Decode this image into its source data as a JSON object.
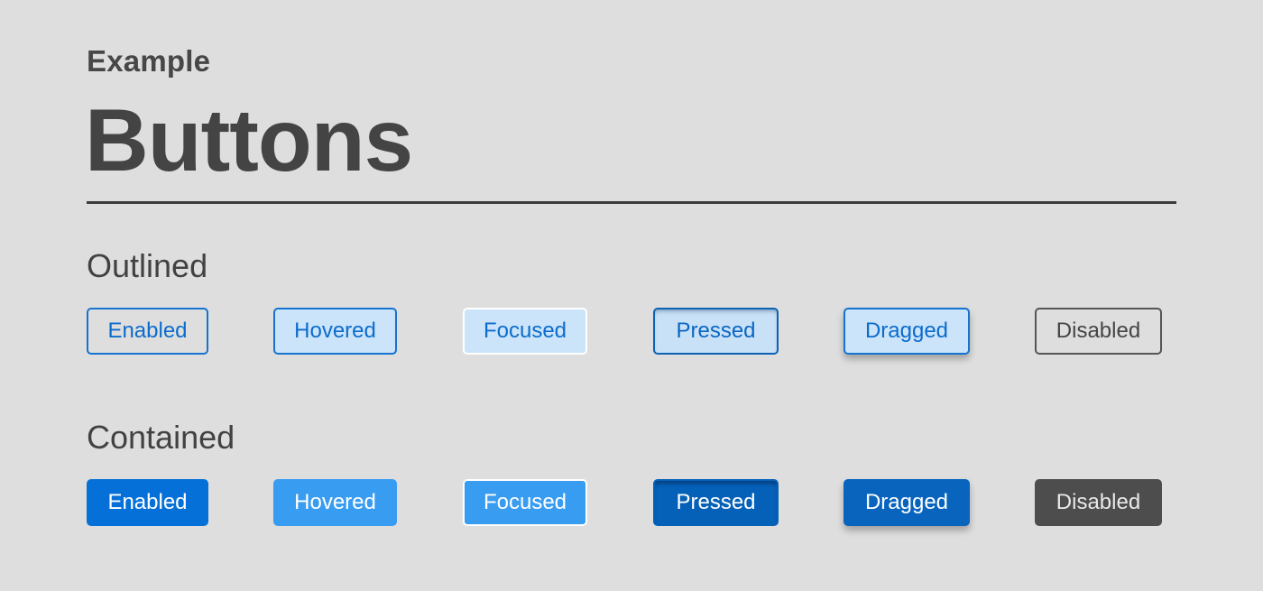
{
  "header": {
    "eyebrow": "Example",
    "title": "Buttons"
  },
  "sections": [
    {
      "heading": "Outlined",
      "buttons": [
        {
          "state": "enabled",
          "label": "Enabled"
        },
        {
          "state": "hovered",
          "label": "Hovered"
        },
        {
          "state": "focused",
          "label": "Focused"
        },
        {
          "state": "pressed",
          "label": "Pressed"
        },
        {
          "state": "dragged",
          "label": "Dragged"
        },
        {
          "state": "disabled",
          "label": "Disabled"
        }
      ]
    },
    {
      "heading": "Contained",
      "buttons": [
        {
          "state": "enabled",
          "label": "Enabled"
        },
        {
          "state": "hovered",
          "label": "Hovered"
        },
        {
          "state": "focused",
          "label": "Focused"
        },
        {
          "state": "pressed",
          "label": "Pressed"
        },
        {
          "state": "dragged",
          "label": "Dragged"
        },
        {
          "state": "disabled",
          "label": "Disabled"
        }
      ]
    }
  ],
  "colors": {
    "background": "#dedede",
    "text": "#454545",
    "primary": "#0571d8",
    "primary_hover": "#389cf1",
    "primary_pressed": "#0561b8",
    "outline_fill_tint": "#cbe4f9",
    "disabled": "#4d4d4d"
  }
}
